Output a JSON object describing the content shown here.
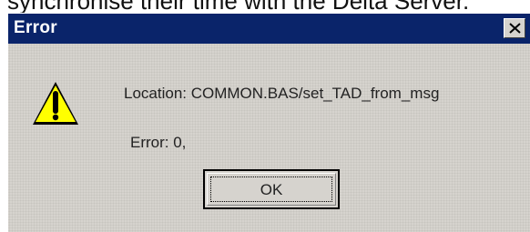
{
  "background": {
    "partial_text": "synchronise their time with the Delta Server."
  },
  "dialog": {
    "title": "Error",
    "close_icon": "close-x-icon",
    "icon": "warning-icon",
    "location_message": "Location: COMMON.BAS/set_TAD_from_msg",
    "error_message": "Error: 0,",
    "ok_label": "OK"
  },
  "colors": {
    "titlebar": "#0a246a",
    "dialog_bg": "#d6d3ce",
    "warning_yellow": "#ffff00"
  }
}
